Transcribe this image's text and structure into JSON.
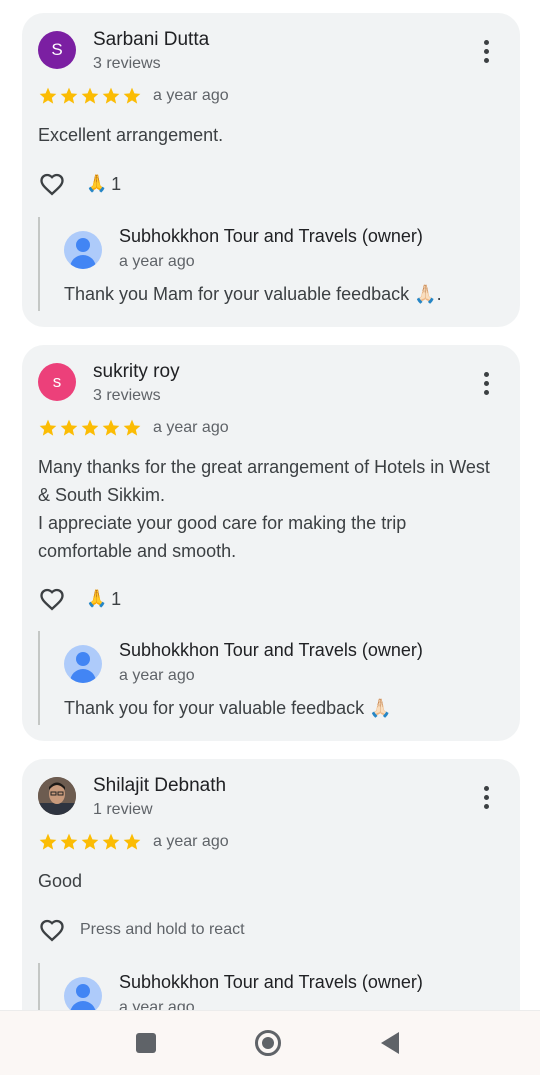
{
  "reviews": [
    {
      "author": "Sarbani Dutta",
      "avatar_letter": "S",
      "avatar_color": "#7b1fa2",
      "review_count": "3 reviews",
      "rating": 5,
      "time": "a year ago",
      "text": "Excellent arrangement.",
      "reaction_emoji": "🙏",
      "reaction_count": "1",
      "reply": {
        "owner": "Subhokkhon Tour and Travels (owner)",
        "time": "a year ago",
        "text": "Thank you Mam for your valuable feedback 🙏🏻."
      }
    },
    {
      "author": "sukrity roy",
      "avatar_letter": "s",
      "avatar_color": "#ec407a",
      "review_count": "3 reviews",
      "rating": 5,
      "time": "a year ago",
      "text": "Many thanks for the great arrangement of Hotels in West & South Sikkim.\nI appreciate your good care for making the trip comfortable and smooth.",
      "reaction_emoji": "🙏",
      "reaction_count": "1",
      "reply": {
        "owner": "Subhokkhon Tour and Travels (owner)",
        "time": "a year ago",
        "text": "Thank you for your valuable feedback 🙏🏻"
      }
    },
    {
      "author": "Shilajit Debnath",
      "review_count": "1 review",
      "rating": 5,
      "time": "a year ago",
      "text": "Good",
      "react_hint": "Press and hold to react",
      "reply": {
        "owner": "Subhokkhon Tour and Travels (owner)",
        "time": "a year ago"
      }
    }
  ],
  "colors": {
    "card_bg": "#f1f3f4",
    "star": "#fbbc04",
    "text_primary": "#202124",
    "text_secondary": "#5f6368"
  },
  "navbar": {
    "icons": [
      "recents-icon",
      "home-icon",
      "back-icon"
    ]
  }
}
